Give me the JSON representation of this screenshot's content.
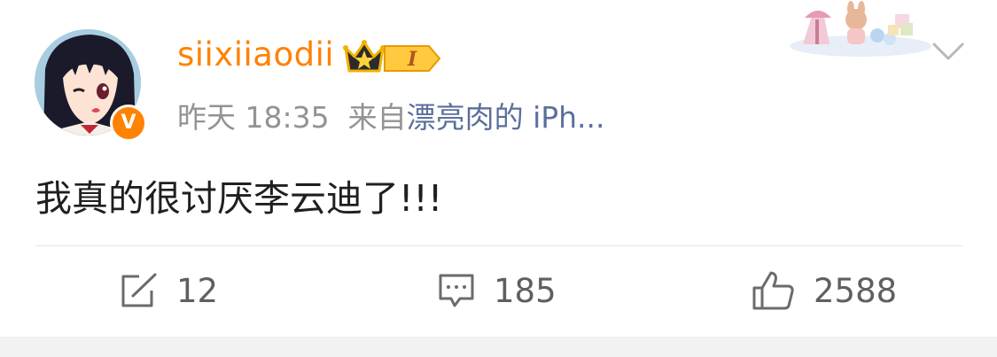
{
  "post": {
    "username": "siixiiaodii",
    "level_badge": "I",
    "time": "昨天 18:35",
    "source_prefix": "来自",
    "source": "漂亮肉的 iPh...",
    "text": "我真的很讨厌李云迪了!!!"
  },
  "actions": {
    "repost_count": "12",
    "comment_count": "185",
    "like_count": "2588"
  },
  "icons": {
    "verified": "verified-v-icon",
    "crown": "crown-icon",
    "repost": "repost-icon",
    "comment": "comment-icon",
    "like": "thumbs-up-icon",
    "more": "chevron-down-icon"
  },
  "colors": {
    "username": "#ff8200",
    "verified": "#ff8200",
    "link": "#5b6f9c",
    "meta": "#939393",
    "text": "#1f1f1f"
  }
}
